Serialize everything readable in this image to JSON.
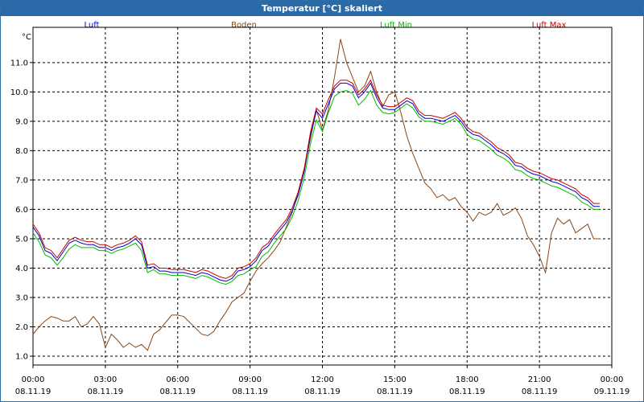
{
  "window": {
    "title": "Temperatur [°C] skaliert"
  },
  "chart_data": {
    "type": "line",
    "title": "Temperatur [°C] skaliert",
    "ylabel": "°C",
    "xlabel": "",
    "ylim": [
      0.7,
      12.2
    ],
    "xlim": [
      0,
      24
    ],
    "grid": true,
    "legend_placement": "top",
    "y_ticks": [
      "1.0",
      "2.0",
      "3.0",
      "4.0",
      "5.0",
      "6.0",
      "7.0",
      "8.0",
      "9.0",
      "10.0",
      "11.0"
    ],
    "x_ticks": [
      {
        "time": "00:00",
        "date": "08.11.19"
      },
      {
        "time": "03:00",
        "date": "08.11.19"
      },
      {
        "time": "06:00",
        "date": "08.11.19"
      },
      {
        "time": "09:00",
        "date": "08.11.19"
      },
      {
        "time": "12:00",
        "date": "08.11.19"
      },
      {
        "time": "15:00",
        "date": "08.11.19"
      },
      {
        "time": "18:00",
        "date": "08.11.19"
      },
      {
        "time": "21:00",
        "date": "08.11.19"
      },
      {
        "time": "00:00",
        "date": "09.11.19"
      }
    ],
    "x": [
      0,
      0.25,
      0.5,
      0.75,
      1,
      1.25,
      1.5,
      1.75,
      2,
      2.25,
      2.5,
      2.75,
      3,
      3.25,
      3.5,
      3.75,
      4,
      4.25,
      4.5,
      4.75,
      5,
      5.25,
      5.5,
      5.75,
      6,
      6.25,
      6.5,
      6.75,
      7,
      7.25,
      7.5,
      7.75,
      8,
      8.25,
      8.5,
      8.75,
      9,
      9.25,
      9.5,
      9.75,
      10,
      10.25,
      10.5,
      10.75,
      11,
      11.25,
      11.5,
      11.75,
      12,
      12.25,
      12.5,
      12.75,
      13,
      13.25,
      13.5,
      13.75,
      14,
      14.25,
      14.5,
      14.75,
      15,
      15.25,
      15.5,
      15.75,
      16,
      16.25,
      16.5,
      16.75,
      17,
      17.25,
      17.5,
      17.75,
      18,
      18.25,
      18.5,
      18.75,
      19,
      19.25,
      19.5,
      19.75,
      20,
      20.25,
      20.5,
      20.75,
      21,
      21.25,
      21.5,
      21.75,
      22,
      22.25,
      22.5,
      22.75,
      23,
      23.25,
      23.5,
      23.75,
      24
    ],
    "series": [
      {
        "name": "Luft",
        "color": "#0000cc",
        "values": [
          5.4,
          5.1,
          4.6,
          4.5,
          4.25,
          4.55,
          4.85,
          4.95,
          4.85,
          4.8,
          4.8,
          4.7,
          4.7,
          4.6,
          4.7,
          4.75,
          4.85,
          5.0,
          4.8,
          4.0,
          4.05,
          3.9,
          3.9,
          3.85,
          3.85,
          3.85,
          3.8,
          3.75,
          3.85,
          3.8,
          3.7,
          3.6,
          3.55,
          3.65,
          3.9,
          3.95,
          4.05,
          4.25,
          4.6,
          4.75,
          5.05,
          5.3,
          5.55,
          5.95,
          6.5,
          7.3,
          8.5,
          9.35,
          9.1,
          9.6,
          10.1,
          10.3,
          10.3,
          10.2,
          9.8,
          10.0,
          10.3,
          9.8,
          9.45,
          9.4,
          9.4,
          9.55,
          9.7,
          9.6,
          9.25,
          9.1,
          9.1,
          9.05,
          9.0,
          9.1,
          9.2,
          9.0,
          8.7,
          8.55,
          8.5,
          8.35,
          8.2,
          8.0,
          7.9,
          7.75,
          7.5,
          7.45,
          7.3,
          7.2,
          7.15,
          7.05,
          6.95,
          6.9,
          6.8,
          6.7,
          6.6,
          6.4,
          6.3,
          6.1,
          6.1
        ]
      },
      {
        "name": "Boden",
        "color": "#8b4513",
        "values": [
          1.75,
          2.0,
          2.2,
          2.35,
          2.3,
          2.2,
          2.2,
          2.35,
          2.0,
          2.1,
          2.35,
          2.1,
          1.3,
          1.75,
          1.55,
          1.3,
          1.45,
          1.3,
          1.4,
          1.2,
          1.75,
          1.9,
          2.15,
          2.4,
          2.4,
          2.35,
          2.15,
          1.95,
          1.75,
          1.7,
          1.85,
          2.2,
          2.5,
          2.85,
          3.0,
          3.15,
          3.55,
          3.9,
          4.15,
          4.35,
          4.6,
          4.9,
          5.4,
          5.9,
          6.6,
          7.4,
          8.4,
          9.4,
          8.7,
          9.4,
          10.5,
          11.8,
          11.0,
          10.5,
          10.0,
          10.2,
          10.7,
          10.0,
          9.5,
          9.9,
          10.0,
          9.3,
          8.5,
          7.9,
          7.4,
          6.9,
          6.7,
          6.4,
          6.5,
          6.3,
          6.4,
          6.1,
          5.9,
          5.6,
          5.9,
          5.8,
          5.9,
          6.2,
          5.8,
          5.9,
          6.05,
          5.7,
          5.1,
          4.8,
          4.4,
          3.85,
          5.2,
          5.7,
          5.5,
          5.65,
          5.2,
          5.35,
          5.5,
          5.0,
          5.0
        ]
      },
      {
        "name": "Luft Min",
        "color": "#00bb00",
        "values": [
          5.2,
          4.9,
          4.45,
          4.35,
          4.1,
          4.35,
          4.65,
          4.8,
          4.7,
          4.7,
          4.7,
          4.6,
          4.6,
          4.5,
          4.6,
          4.65,
          4.75,
          4.85,
          4.6,
          3.85,
          3.95,
          3.8,
          3.8,
          3.75,
          3.75,
          3.75,
          3.7,
          3.65,
          3.75,
          3.7,
          3.6,
          3.5,
          3.45,
          3.55,
          3.75,
          3.8,
          3.95,
          4.05,
          4.4,
          4.55,
          4.85,
          5.1,
          5.35,
          5.75,
          6.3,
          7.1,
          8.2,
          9.05,
          8.65,
          9.3,
          9.85,
          10.0,
          10.05,
          9.95,
          9.55,
          9.75,
          10.05,
          9.55,
          9.3,
          9.25,
          9.3,
          9.45,
          9.6,
          9.45,
          9.15,
          9.0,
          9.0,
          8.95,
          8.9,
          9.0,
          9.1,
          8.9,
          8.55,
          8.4,
          8.35,
          8.2,
          8.05,
          7.85,
          7.75,
          7.6,
          7.35,
          7.3,
          7.15,
          7.05,
          7.0,
          6.9,
          6.8,
          6.75,
          6.65,
          6.55,
          6.45,
          6.25,
          6.15,
          6.0,
          6.0
        ]
      },
      {
        "name": "Luft Max",
        "color": "#cc0000",
        "values": [
          5.5,
          5.2,
          4.7,
          4.6,
          4.35,
          4.65,
          4.95,
          5.05,
          4.95,
          4.9,
          4.9,
          4.8,
          4.8,
          4.7,
          4.8,
          4.85,
          4.95,
          5.1,
          4.9,
          4.1,
          4.15,
          4.0,
          4.0,
          3.95,
          3.95,
          3.95,
          3.9,
          3.85,
          3.95,
          3.9,
          3.8,
          3.7,
          3.65,
          3.75,
          4.0,
          4.05,
          4.15,
          4.35,
          4.7,
          4.85,
          5.15,
          5.4,
          5.65,
          6.05,
          6.6,
          7.4,
          8.6,
          9.45,
          9.25,
          9.75,
          10.2,
          10.4,
          10.4,
          10.3,
          9.9,
          10.1,
          10.4,
          9.9,
          9.55,
          9.5,
          9.5,
          9.65,
          9.8,
          9.7,
          9.35,
          9.2,
          9.2,
          9.15,
          9.1,
          9.2,
          9.3,
          9.1,
          8.8,
          8.65,
          8.6,
          8.45,
          8.3,
          8.1,
          8.0,
          7.85,
          7.6,
          7.55,
          7.4,
          7.3,
          7.25,
          7.15,
          7.05,
          7.0,
          6.9,
          6.8,
          6.7,
          6.5,
          6.4,
          6.2,
          6.2
        ]
      }
    ]
  }
}
